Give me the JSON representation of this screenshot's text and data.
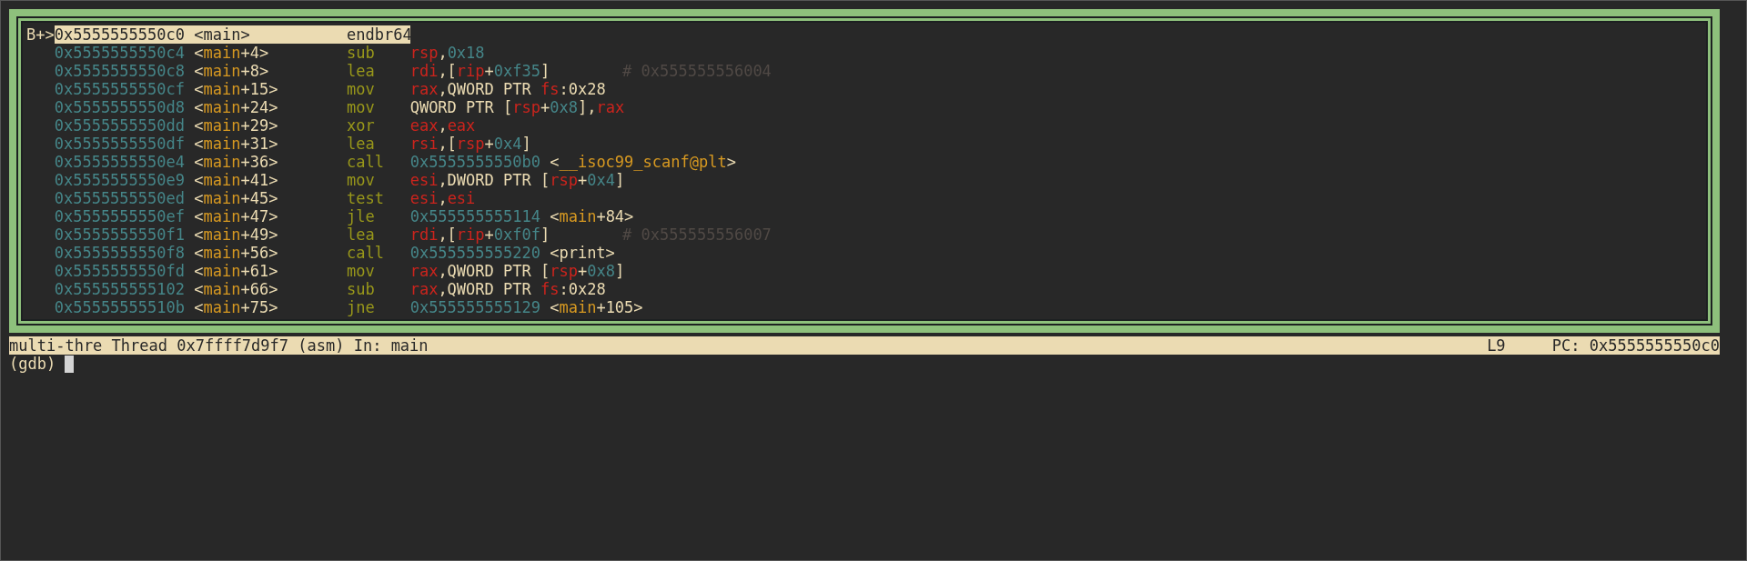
{
  "asm_window": {
    "lines": [
      {
        "marker": "B+>",
        "current": true,
        "address": "0x5555555550c0",
        "symbol": [
          {
            "text": "<main>",
            "kind": "text"
          }
        ],
        "mnemonic": "endbr64"
      },
      {
        "current": false,
        "address": "0x5555555550c4",
        "symbol": [
          {
            "text": "<",
            "kind": "text"
          },
          {
            "text": "main",
            "kind": "sym"
          },
          {
            "text": "+4>",
            "kind": "text"
          }
        ],
        "mnemonic": "sub",
        "operands": [
          {
            "text": "rsp",
            "kind": "reg"
          },
          {
            "text": ",",
            "kind": "text"
          },
          {
            "text": "0x18",
            "kind": "num"
          }
        ]
      },
      {
        "current": false,
        "address": "0x5555555550c8",
        "symbol": [
          {
            "text": "<",
            "kind": "text"
          },
          {
            "text": "main",
            "kind": "sym"
          },
          {
            "text": "+8>",
            "kind": "text"
          }
        ],
        "mnemonic": "lea",
        "operands": [
          {
            "text": "rdi",
            "kind": "reg"
          },
          {
            "text": ",[",
            "kind": "text"
          },
          {
            "text": "rip",
            "kind": "reg"
          },
          {
            "text": "+",
            "kind": "text"
          },
          {
            "text": "0xf35",
            "kind": "num"
          },
          {
            "text": "]",
            "kind": "text"
          }
        ],
        "comment": "# 0x555555556004"
      },
      {
        "current": false,
        "address": "0x5555555550cf",
        "symbol": [
          {
            "text": "<",
            "kind": "text"
          },
          {
            "text": "main",
            "kind": "sym"
          },
          {
            "text": "+15>",
            "kind": "text"
          }
        ],
        "mnemonic": "mov",
        "operands": [
          {
            "text": "rax",
            "kind": "reg"
          },
          {
            "text": ",QWORD PTR ",
            "kind": "text"
          },
          {
            "text": "fs",
            "kind": "reg"
          },
          {
            "text": ":0x28",
            "kind": "text"
          }
        ]
      },
      {
        "current": false,
        "address": "0x5555555550d8",
        "symbol": [
          {
            "text": "<",
            "kind": "text"
          },
          {
            "text": "main",
            "kind": "sym"
          },
          {
            "text": "+24>",
            "kind": "text"
          }
        ],
        "mnemonic": "mov",
        "operands": [
          {
            "text": "QWORD PTR [",
            "kind": "text"
          },
          {
            "text": "rsp",
            "kind": "reg"
          },
          {
            "text": "+",
            "kind": "text"
          },
          {
            "text": "0x8",
            "kind": "num"
          },
          {
            "text": "],",
            "kind": "text"
          },
          {
            "text": "rax",
            "kind": "reg"
          }
        ]
      },
      {
        "current": false,
        "address": "0x5555555550dd",
        "symbol": [
          {
            "text": "<",
            "kind": "text"
          },
          {
            "text": "main",
            "kind": "sym"
          },
          {
            "text": "+29>",
            "kind": "text"
          }
        ],
        "mnemonic": "xor",
        "operands": [
          {
            "text": "eax",
            "kind": "reg"
          },
          {
            "text": ",",
            "kind": "text"
          },
          {
            "text": "eax",
            "kind": "reg"
          }
        ]
      },
      {
        "current": false,
        "address": "0x5555555550df",
        "symbol": [
          {
            "text": "<",
            "kind": "text"
          },
          {
            "text": "main",
            "kind": "sym"
          },
          {
            "text": "+31>",
            "kind": "text"
          }
        ],
        "mnemonic": "lea",
        "operands": [
          {
            "text": "rsi",
            "kind": "reg"
          },
          {
            "text": ",[",
            "kind": "text"
          },
          {
            "text": "rsp",
            "kind": "reg"
          },
          {
            "text": "+",
            "kind": "text"
          },
          {
            "text": "0x4",
            "kind": "num"
          },
          {
            "text": "]",
            "kind": "text"
          }
        ]
      },
      {
        "current": false,
        "address": "0x5555555550e4",
        "symbol": [
          {
            "text": "<",
            "kind": "text"
          },
          {
            "text": "main",
            "kind": "sym"
          },
          {
            "text": "+36>",
            "kind": "text"
          }
        ],
        "mnemonic": "call",
        "operands": [
          {
            "text": "0x5555555550b0",
            "kind": "num"
          },
          {
            "text": " <",
            "kind": "text"
          },
          {
            "text": "__isoc99_scanf@plt",
            "kind": "sym"
          },
          {
            "text": ">",
            "kind": "text"
          }
        ]
      },
      {
        "current": false,
        "address": "0x5555555550e9",
        "symbol": [
          {
            "text": "<",
            "kind": "text"
          },
          {
            "text": "main",
            "kind": "sym"
          },
          {
            "text": "+41>",
            "kind": "text"
          }
        ],
        "mnemonic": "mov",
        "operands": [
          {
            "text": "esi",
            "kind": "reg"
          },
          {
            "text": ",DWORD PTR [",
            "kind": "text"
          },
          {
            "text": "rsp",
            "kind": "reg"
          },
          {
            "text": "+",
            "kind": "text"
          },
          {
            "text": "0x4",
            "kind": "num"
          },
          {
            "text": "]",
            "kind": "text"
          }
        ]
      },
      {
        "current": false,
        "address": "0x5555555550ed",
        "symbol": [
          {
            "text": "<",
            "kind": "text"
          },
          {
            "text": "main",
            "kind": "sym"
          },
          {
            "text": "+45>",
            "kind": "text"
          }
        ],
        "mnemonic": "test",
        "operands": [
          {
            "text": "esi",
            "kind": "reg"
          },
          {
            "text": ",",
            "kind": "text"
          },
          {
            "text": "esi",
            "kind": "reg"
          }
        ]
      },
      {
        "current": false,
        "address": "0x5555555550ef",
        "symbol": [
          {
            "text": "<",
            "kind": "text"
          },
          {
            "text": "main",
            "kind": "sym"
          },
          {
            "text": "+47>",
            "kind": "text"
          }
        ],
        "mnemonic": "jle",
        "operands": [
          {
            "text": "0x555555555114",
            "kind": "num"
          },
          {
            "text": " <",
            "kind": "text"
          },
          {
            "text": "main",
            "kind": "sym"
          },
          {
            "text": "+84>",
            "kind": "text"
          }
        ]
      },
      {
        "current": false,
        "address": "0x5555555550f1",
        "symbol": [
          {
            "text": "<",
            "kind": "text"
          },
          {
            "text": "main",
            "kind": "sym"
          },
          {
            "text": "+49>",
            "kind": "text"
          }
        ],
        "mnemonic": "lea",
        "operands": [
          {
            "text": "rdi",
            "kind": "reg"
          },
          {
            "text": ",[",
            "kind": "text"
          },
          {
            "text": "rip",
            "kind": "reg"
          },
          {
            "text": "+",
            "kind": "text"
          },
          {
            "text": "0xf0f",
            "kind": "num"
          },
          {
            "text": "]",
            "kind": "text"
          }
        ],
        "comment": "# 0x555555556007"
      },
      {
        "current": false,
        "address": "0x5555555550f8",
        "symbol": [
          {
            "text": "<",
            "kind": "text"
          },
          {
            "text": "main",
            "kind": "sym"
          },
          {
            "text": "+56>",
            "kind": "text"
          }
        ],
        "mnemonic": "call",
        "operands": [
          {
            "text": "0x555555555220",
            "kind": "num"
          },
          {
            "text": " <print>",
            "kind": "text"
          }
        ]
      },
      {
        "current": false,
        "address": "0x5555555550fd",
        "symbol": [
          {
            "text": "<",
            "kind": "text"
          },
          {
            "text": "main",
            "kind": "sym"
          },
          {
            "text": "+61>",
            "kind": "text"
          }
        ],
        "mnemonic": "mov",
        "operands": [
          {
            "text": "rax",
            "kind": "reg"
          },
          {
            "text": ",QWORD PTR [",
            "kind": "text"
          },
          {
            "text": "rsp",
            "kind": "reg"
          },
          {
            "text": "+",
            "kind": "text"
          },
          {
            "text": "0x8",
            "kind": "num"
          },
          {
            "text": "]",
            "kind": "text"
          }
        ]
      },
      {
        "current": false,
        "address": "0x555555555102",
        "symbol": [
          {
            "text": "<",
            "kind": "text"
          },
          {
            "text": "main",
            "kind": "sym"
          },
          {
            "text": "+66>",
            "kind": "text"
          }
        ],
        "mnemonic": "sub",
        "operands": [
          {
            "text": "rax",
            "kind": "reg"
          },
          {
            "text": ",QWORD PTR ",
            "kind": "text"
          },
          {
            "text": "fs",
            "kind": "reg"
          },
          {
            "text": ":0x28",
            "kind": "text"
          }
        ]
      },
      {
        "current": false,
        "address": "0x55555555510b",
        "symbol": [
          {
            "text": "<",
            "kind": "text"
          },
          {
            "text": "main",
            "kind": "sym"
          },
          {
            "text": "+75>",
            "kind": "text"
          }
        ],
        "mnemonic": "jne",
        "operands": [
          {
            "text": "0x555555555129",
            "kind": "num"
          },
          {
            "text": " <",
            "kind": "text"
          },
          {
            "text": "main",
            "kind": "sym"
          },
          {
            "text": "+105>",
            "kind": "text"
          }
        ]
      }
    ]
  },
  "status_bar": {
    "left": "multi-thre Thread 0x7ffff7d9f7 (asm) In: main",
    "line": "L9",
    "pc": "PC: 0x5555555550c0"
  },
  "prompt": "(gdb)"
}
